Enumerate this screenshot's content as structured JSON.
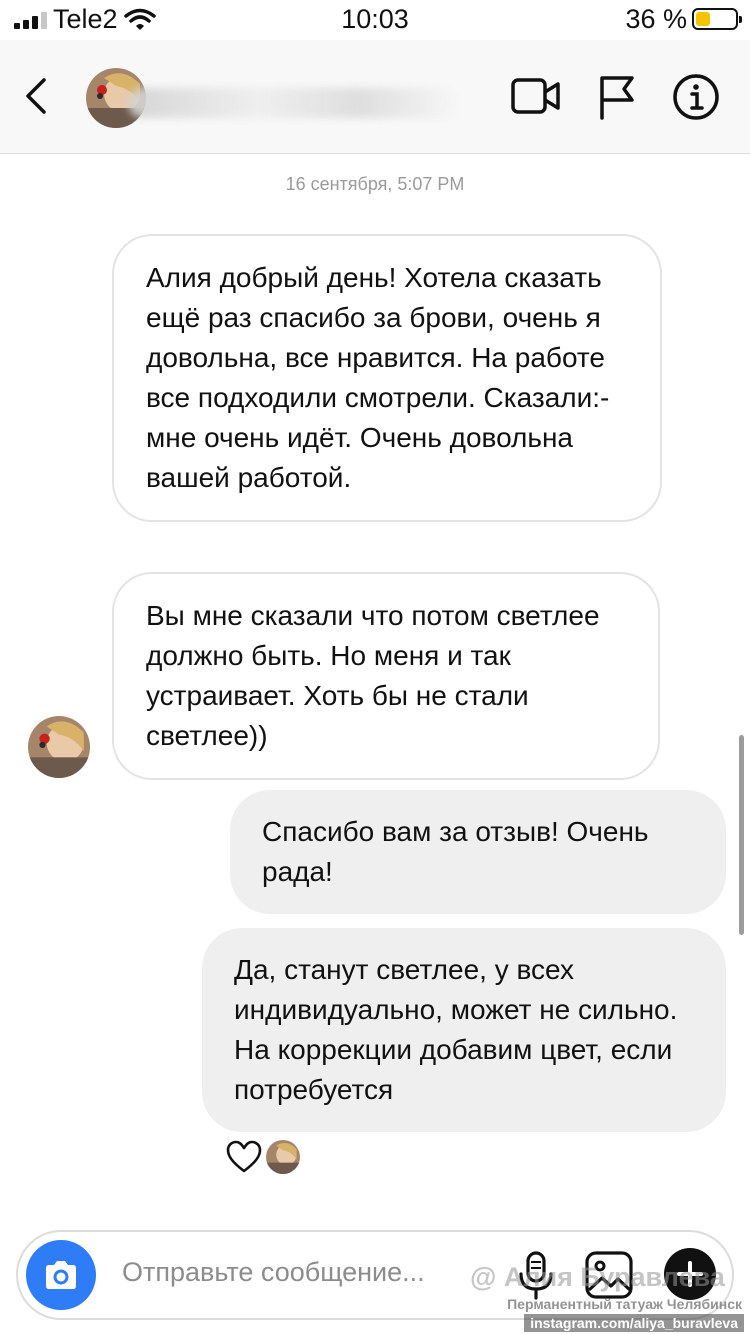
{
  "status_bar": {
    "carrier": "Tele2",
    "time": "10:03",
    "battery_percent": "36 %",
    "battery_level": 0.36
  },
  "header": {
    "icons": [
      "back-icon",
      "video-call-icon",
      "flag-icon",
      "info-icon"
    ]
  },
  "conversation": {
    "timestamp": "16 сентября, 5:07 PM",
    "messages": [
      {
        "sender": "them",
        "text": "Алия добрый день! Хотела сказать ещё раз спасибо за брови, очень я довольна, все нравится.  На работе все подходили смотрели. Сказали:- мне очень идёт.  Очень довольна вашей работой."
      },
      {
        "sender": "them",
        "text": "Вы мне сказали что потом светлее должно быть. Но меня и так устраивает. Хоть бы не стали светлее))"
      },
      {
        "sender": "me",
        "text": "Спасибо вам за отзыв! Очень рада!"
      },
      {
        "sender": "me",
        "text": "Да, станут светлее, у всех индивидуально, может не сильно. На коррекции добавим цвет, если потребуется"
      }
    ],
    "reaction": "heart-icon"
  },
  "composer": {
    "placeholder": "Отправьте сообщение...",
    "icons": [
      "camera-icon",
      "microphone-icon",
      "gallery-icon",
      "plus-icon"
    ],
    "accent_color": "#2e7cf6"
  },
  "watermark": {
    "title": "@ Алия Буравлева",
    "subtitle": "Перманентный татуаж Челябинск",
    "url": "instagram.com/aliya_buravleva"
  }
}
